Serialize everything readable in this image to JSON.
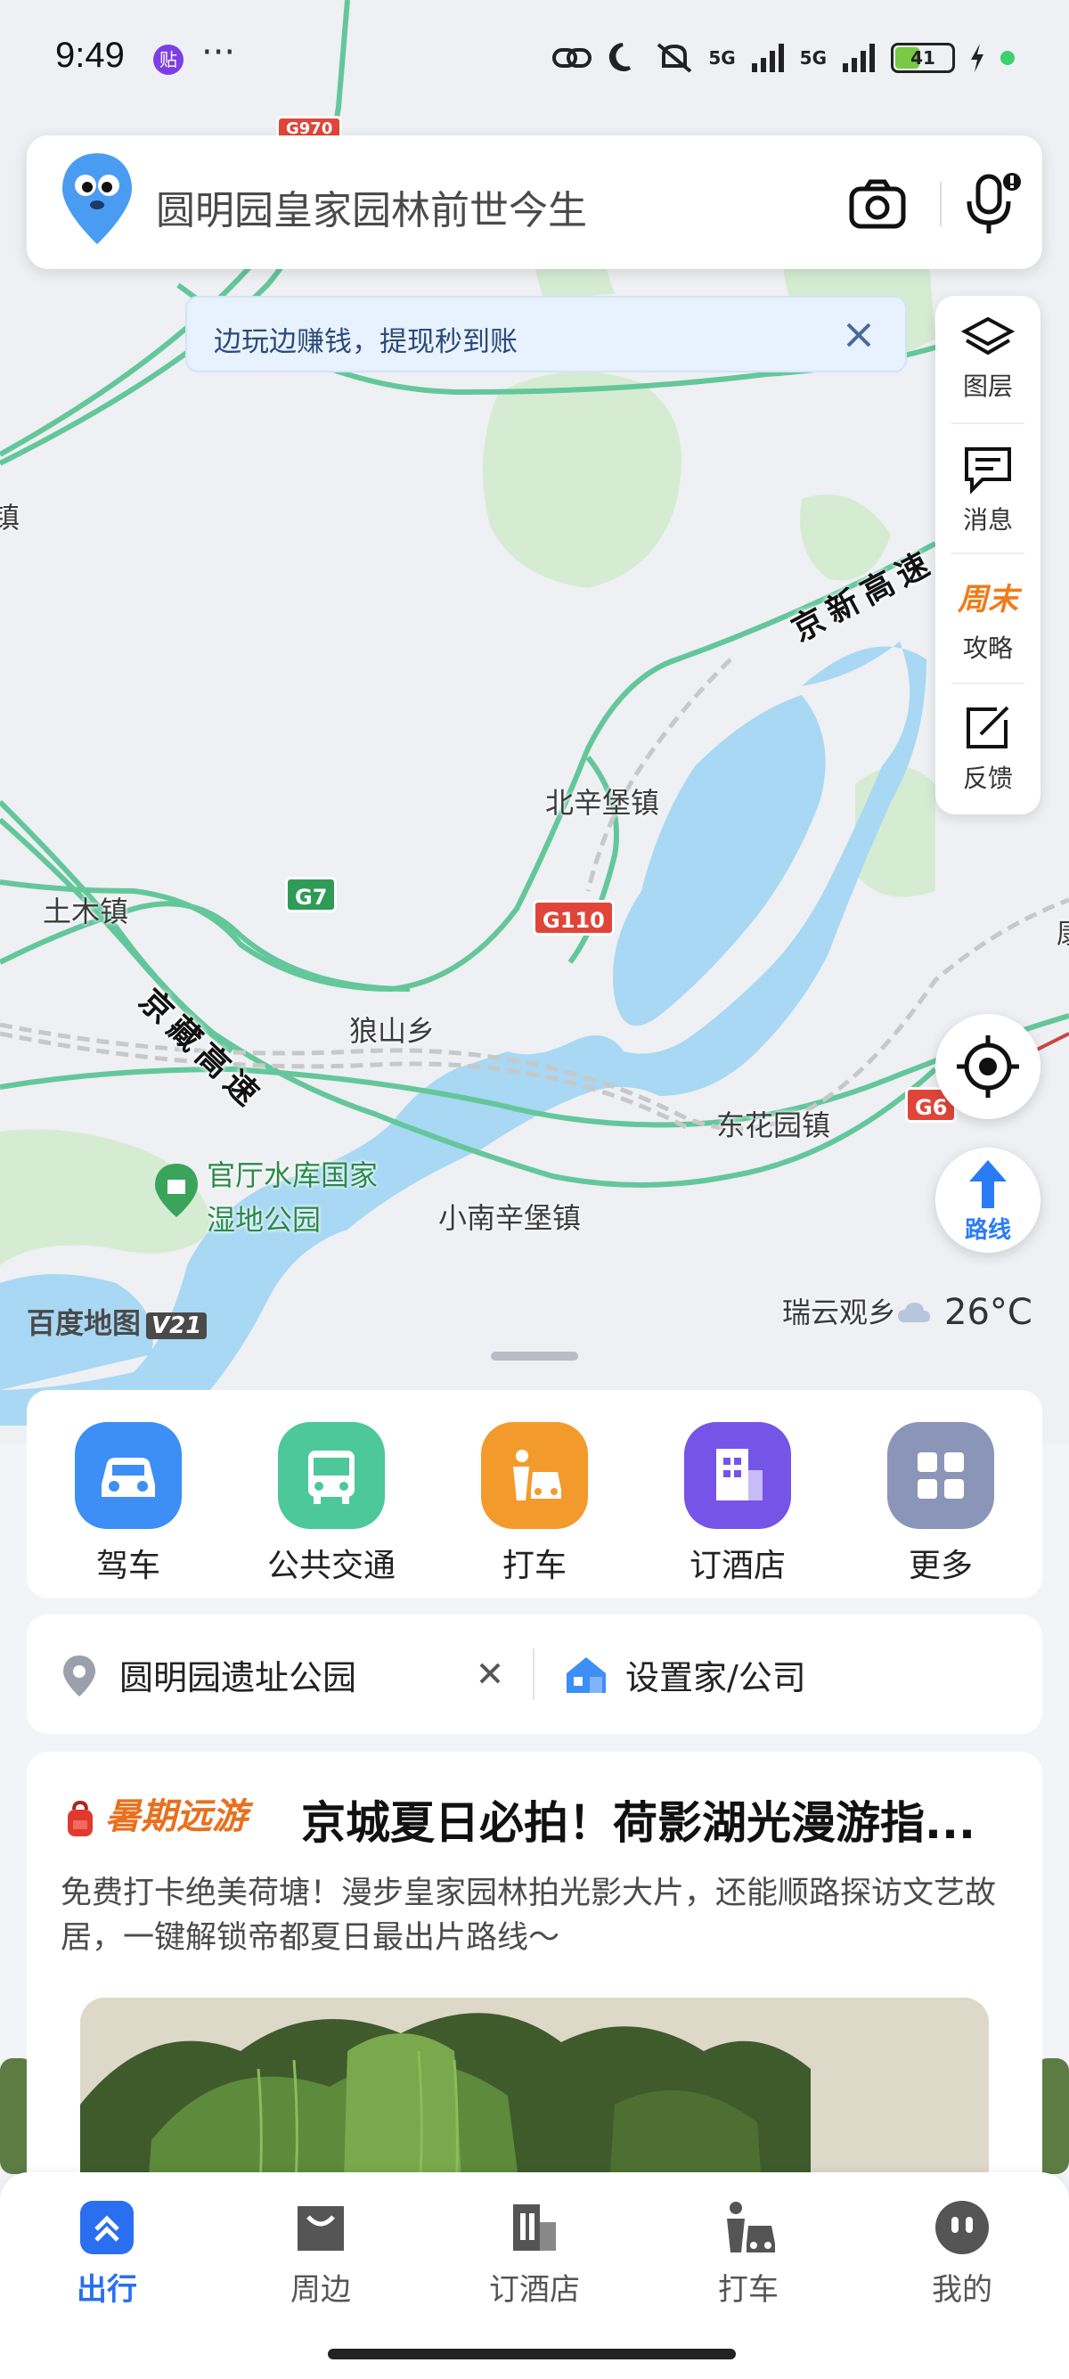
{
  "status_bar": {
    "time": "9:49",
    "badge": "贴",
    "more": "···",
    "battery": "41",
    "net1": "5G",
    "net2": "5G"
  },
  "search": {
    "placeholder": "圆明园皇家园林前世今生"
  },
  "promo": {
    "text": "边玩边赚钱，提现秒到账"
  },
  "side_panel": {
    "items": [
      {
        "label": "图层",
        "icon": "layers-icon"
      },
      {
        "label": "消息",
        "icon": "message-icon"
      },
      {
        "label": "攻略",
        "icon": "weekend-guide-icon",
        "tag": "周末"
      },
      {
        "label": "反馈",
        "icon": "feedback-icon"
      }
    ]
  },
  "map": {
    "labels": {
      "town1": "北辛堡镇",
      "town2": "土木镇",
      "town3": "狼山乡",
      "town4": "东花园镇",
      "town5": "小南辛堡镇",
      "park_line1": "官厅水库国家",
      "park_line2": "湿地公园",
      "town6": "瑞云观乡",
      "left_edge": "镇",
      "right_edge": "康"
    },
    "highways": {
      "jingxin": "京新高速",
      "jingzang": "京藏高速"
    },
    "shields": {
      "g7": "G7",
      "g110": "G110",
      "g6": "G6",
      "top": "G970"
    },
    "brand": "百度地图",
    "brand_version": "V21",
    "temperature": "26°C",
    "route_label": "路线"
  },
  "quick_actions": [
    {
      "label": "驾车",
      "icon": "car-icon",
      "color": "#3d8ef5"
    },
    {
      "label": "公共交通",
      "icon": "bus-icon",
      "color": "#4cc89a"
    },
    {
      "label": "打车",
      "icon": "taxi-icon",
      "color": "#f39a2c"
    },
    {
      "label": "订酒店",
      "icon": "hotel-icon",
      "color": "#7654e8"
    },
    {
      "label": "更多",
      "icon": "grid-icon",
      "color": "#8b95b8"
    }
  ],
  "recent": {
    "place": "圆明园遗址公园",
    "home": "设置家/公司"
  },
  "article": {
    "tag": "暑期远游",
    "title": "京城夏日必拍！荷影湖光漫游指...",
    "desc": "免费打卡绝美荷塘！漫步皇家园林拍光影大片，还能顺路探访文艺故居，一键解锁帝都夏日最出片路线～"
  },
  "tabs": [
    {
      "label": "出行",
      "icon": "travel-icon",
      "active": true
    },
    {
      "label": "周边",
      "icon": "nearby-icon",
      "active": false
    },
    {
      "label": "订酒店",
      "icon": "hotel-tab-icon",
      "active": false
    },
    {
      "label": "打车",
      "icon": "taxi-tab-icon",
      "active": false
    },
    {
      "label": "我的",
      "icon": "profile-icon",
      "active": false
    }
  ]
}
